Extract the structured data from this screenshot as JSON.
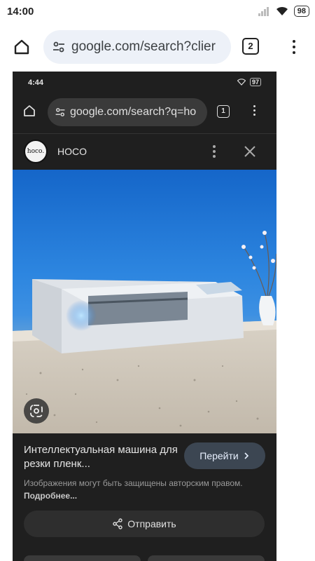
{
  "status_bar": {
    "time": "14:00",
    "battery": "98"
  },
  "browser": {
    "url": "google.com/search?clier",
    "tab_count": "2"
  },
  "inner_screenshot": {
    "status_time": "4:44",
    "status_battery": "97",
    "url": "google.com/search?q=ho",
    "tab_count": "1",
    "source_name": "HOCO",
    "logo_text": "hoco.",
    "image_subject": "cutting plotter machine on granite countertop",
    "caption": "Интеллектуальная машина для резки пленк...",
    "go_button": "Перейти",
    "copyright_note": "Изображения могут быть защищены авторским правом.",
    "more_link": "Подробнее...",
    "share_button": "Отправить"
  },
  "colors": {
    "panel_bg": "#1f1f1f",
    "go_button_bg": "#3c4652",
    "url_bar_bg": "#edf1f8"
  }
}
